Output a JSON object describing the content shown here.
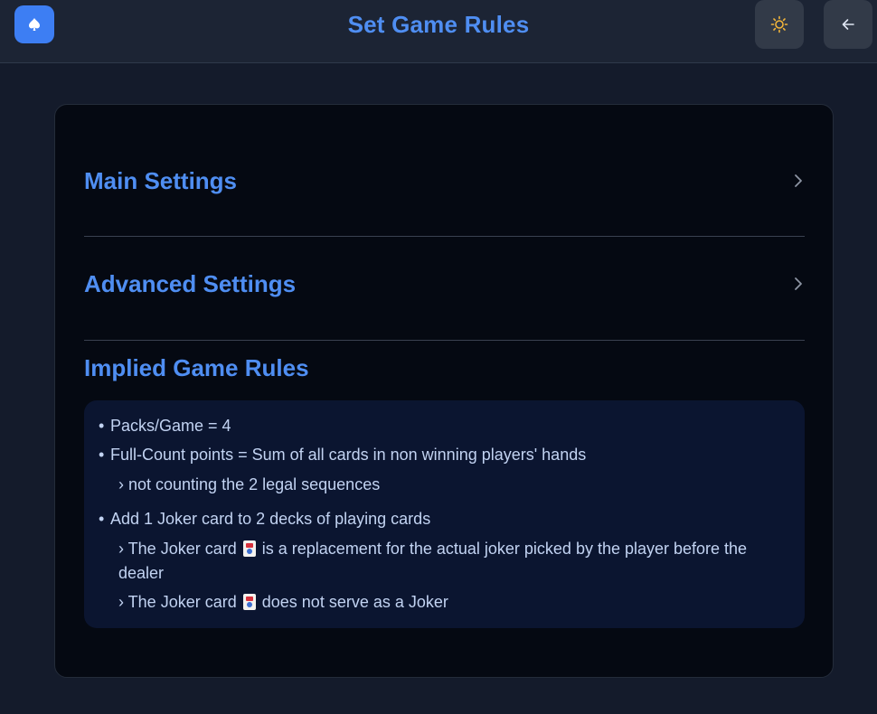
{
  "header": {
    "title": "Set Game Rules",
    "logo_icon": "spade-icon",
    "theme_icon": "sun-icon",
    "back_icon": "arrow-left-icon"
  },
  "sections": [
    {
      "label": "Main Settings",
      "icon": "chevron-right-icon"
    },
    {
      "label": "Advanced Settings",
      "icon": "chevron-right-icon"
    }
  ],
  "implied": {
    "title": "Implied Game Rules",
    "rules": [
      {
        "bullet": "•",
        "text": "Packs/Game = 4"
      },
      {
        "bullet": "•",
        "text": "Full-Count points = Sum of all cards in non winning players' hands"
      },
      {
        "sub": "› not counting the 2 legal sequences"
      },
      {
        "bullet": "•",
        "text": "Add 1 Joker card to 2 decks of playing cards"
      },
      {
        "sub_pre": "› The Joker card",
        "sub_post": "is a replacement for the actual joker picked by the player before the dealer"
      },
      {
        "sub_pre": "› The Joker card",
        "sub_post": "does not serve as a Joker"
      }
    ]
  },
  "colors": {
    "accent": "#4f8ef2",
    "logo_bg": "#3d7ef3",
    "page_bg": "#141b2b",
    "card_bg": "#050912",
    "rules_bg": "#0b1530",
    "sun": "#f2b53a"
  }
}
